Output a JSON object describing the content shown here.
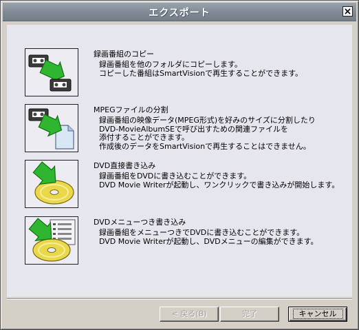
{
  "window": {
    "title": "エクスポート"
  },
  "items": [
    {
      "title": "録画番組のコピー",
      "lines": [
        "録画番組を他のフォルダにコピーします。",
        "コピーした番組はSmartVisionで再生することができます。"
      ],
      "icon": "video-tape-copy-icon"
    },
    {
      "title": "MPEGファイルの分割",
      "lines": [
        "録画番組の映像データ(MPEG形式)を好みのサイズに分割したり",
        "DVD-MovieAlbumSEで呼び出すための関連ファイルを",
        "添付することができます。",
        "作成後のデータをSmartVisionで再生することはできません。"
      ],
      "icon": "mpeg-split-icon"
    },
    {
      "title": "DVD直接書き込み",
      "lines": [
        "録画番組をDVDに書き込むことができます。",
        "DVD Movie Writerが起動し、ワンクリックで書き込みが開始します。"
      ],
      "icon": "dvd-write-icon"
    },
    {
      "title": "DVDメニューつき書き込み",
      "lines": [
        "録画番組をメニューつきでDVDに書き込むことができます。",
        "DVD Movie Writerが起動し、DVDメニューの編集ができます。"
      ],
      "icon": "dvd-menu-write-icon"
    }
  ],
  "buttons": {
    "back": "< 戻る(B)",
    "finish": "完了",
    "cancel": "キャンセル"
  },
  "colors": {
    "titlebar": "#808b96",
    "arrow_green": "#2fb52f",
    "disc_yellow": "#e8d84a"
  }
}
